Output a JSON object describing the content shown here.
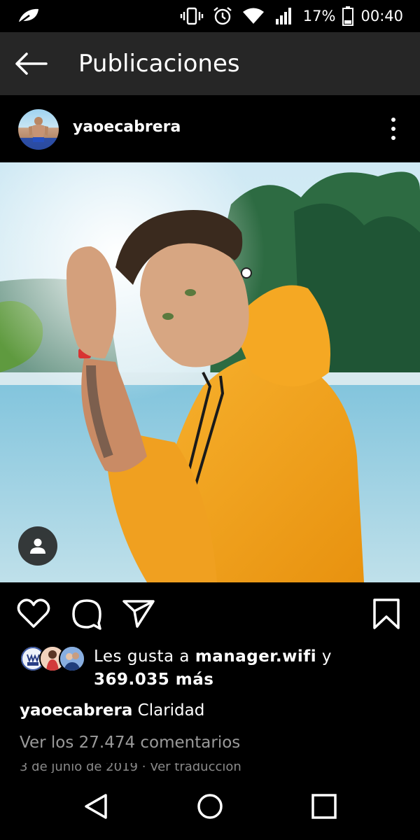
{
  "status_bar": {
    "app_icon": "leaf-icon",
    "icons": [
      "vibrate-icon",
      "alarm-icon",
      "wifi-icon",
      "signal-icon"
    ],
    "battery_percent": "17%",
    "battery_icon": "battery-icon",
    "time": "00:40"
  },
  "app_bar": {
    "back_icon": "arrow-left-icon",
    "title": "Publicaciones"
  },
  "post": {
    "username": "yaoecabrera",
    "more_icon": "more-vertical-icon",
    "photo_alt": "photo",
    "tag_icon": "person-icon",
    "actions": {
      "like_icon": "heart-icon",
      "comment_icon": "comment-icon",
      "share_icon": "send-icon",
      "save_icon": "bookmark-icon"
    },
    "likes": {
      "prefix": "Les gusta a ",
      "user": "manager.wifi",
      "middle": " y ",
      "count": "369.035 más"
    },
    "caption": {
      "username": "yaoecabrera",
      "text": "Claridad"
    },
    "comments_link": "Ver los 27.474 comentarios",
    "date": "3 de junio de 2019",
    "separator": " · ",
    "translate_link": "Ver traducción"
  },
  "nav_bar": {
    "back_icon": "triangle-back-icon",
    "home_icon": "circle-home-icon",
    "recents_icon": "square-recents-icon"
  },
  "colors": {
    "background": "#000000",
    "app_bar": "#262626",
    "muted_text": "#9a9a9a",
    "hoodie": "#f2a21b"
  }
}
